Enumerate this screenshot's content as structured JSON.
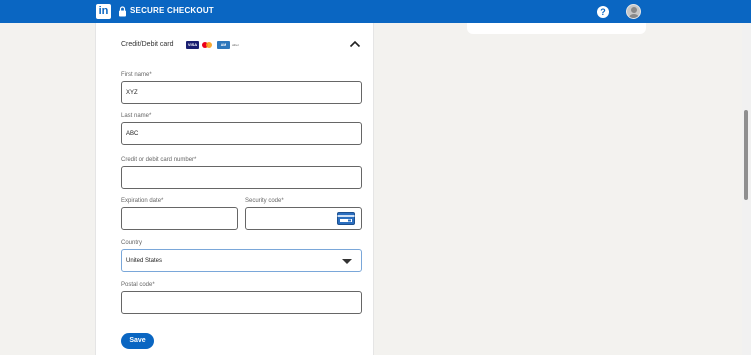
{
  "header": {
    "logo_text": "in",
    "secure_checkout": "SECURE CHECKOUT",
    "help_icon": "?",
    "brand_color": "#0a66c2"
  },
  "payment": {
    "method_title": "Credit/Debit card",
    "card_logos": {
      "visa": "VISA",
      "amex": "AM",
      "other": "other"
    }
  },
  "form": {
    "first_name": {
      "label": "First name*",
      "value": "XYZ"
    },
    "last_name": {
      "label": "Last name*",
      "value": "ABC"
    },
    "card_number": {
      "label": "Credit or debit card number*",
      "value": ""
    },
    "expiration": {
      "label": "Expiration date*",
      "value": ""
    },
    "security_code": {
      "label": "Security code*",
      "value": ""
    },
    "country": {
      "label": "Country",
      "value": "United States"
    },
    "postal_code": {
      "label": "Postal code*",
      "value": ""
    },
    "save_label": "Save"
  }
}
